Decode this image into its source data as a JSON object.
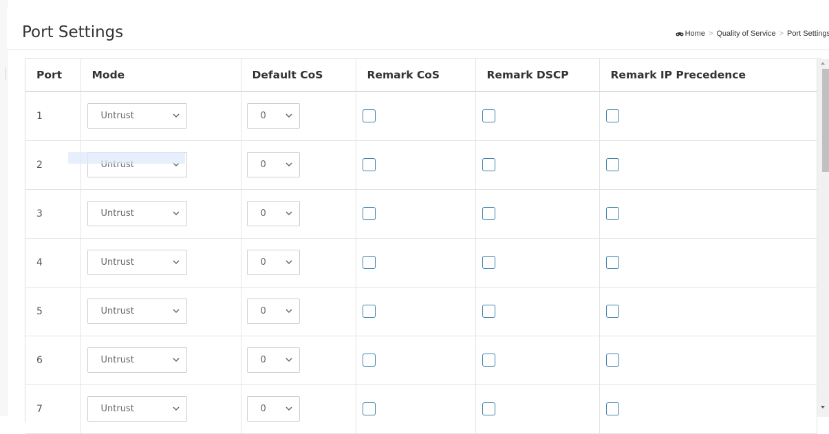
{
  "header": {
    "title": "Port Settings",
    "breadcrumb": [
      "Home",
      "Quality of Service",
      "Port Settings"
    ]
  },
  "table": {
    "columns": [
      "Port",
      "Mode",
      "Default CoS",
      "Remark CoS",
      "Remark DSCP",
      "Remark IP Precedence"
    ],
    "rows": [
      {
        "port": "1",
        "mode": "Untrust",
        "default_cos": "0",
        "remark_cos": false,
        "remark_dscp": false,
        "remark_ip_precedence": false
      },
      {
        "port": "2",
        "mode": "Untrust",
        "default_cos": "0",
        "remark_cos": false,
        "remark_dscp": false,
        "remark_ip_precedence": false
      },
      {
        "port": "3",
        "mode": "Untrust",
        "default_cos": "0",
        "remark_cos": false,
        "remark_dscp": false,
        "remark_ip_precedence": false
      },
      {
        "port": "4",
        "mode": "Untrust",
        "default_cos": "0",
        "remark_cos": false,
        "remark_dscp": false,
        "remark_ip_precedence": false
      },
      {
        "port": "5",
        "mode": "Untrust",
        "default_cos": "0",
        "remark_cos": false,
        "remark_dscp": false,
        "remark_ip_precedence": false
      },
      {
        "port": "6",
        "mode": "Untrust",
        "default_cos": "0",
        "remark_cos": false,
        "remark_dscp": false,
        "remark_ip_precedence": false
      },
      {
        "port": "7",
        "mode": "Untrust",
        "default_cos": "0",
        "remark_cos": false,
        "remark_dscp": false,
        "remark_ip_precedence": false
      }
    ]
  },
  "colors": {
    "checkbox_border": "#3a7fa8",
    "header_text": "#333333",
    "grid_line": "#e3e3e3"
  },
  "icons": {
    "breadcrumb_home": "home-icon",
    "select_arrow": "chevron-down-icon"
  }
}
